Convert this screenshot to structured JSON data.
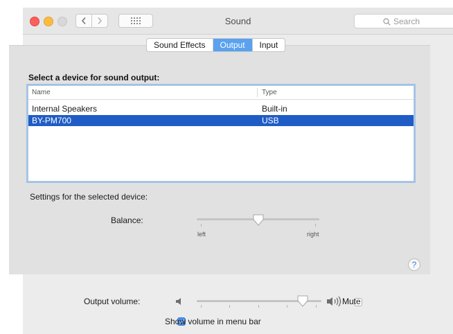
{
  "window": {
    "title": "Sound"
  },
  "search": {
    "placeholder": "Search",
    "icon": "magnifier-icon"
  },
  "tabs": [
    {
      "label": "Sound Effects",
      "active": false
    },
    {
      "label": "Output",
      "active": true
    },
    {
      "label": "Input",
      "active": false
    }
  ],
  "output": {
    "section_title": "Select a device for sound output:",
    "columns": {
      "name": "Name",
      "type": "Type"
    },
    "devices": [
      {
        "name": "Internal Speakers",
        "type": "Built-in",
        "selected": false
      },
      {
        "name": "BY-PM700",
        "type": "USB",
        "selected": true
      }
    ],
    "settings_label": "Settings for the selected device:",
    "balance": {
      "label": "Balance:",
      "left_label": "left",
      "right_label": "right",
      "value": 0.5
    }
  },
  "help": {
    "label": "?"
  },
  "volume": {
    "label": "Output volume:",
    "value": 0.85,
    "mute_label": "Mute",
    "muted": false
  },
  "menu_bar": {
    "label": "Show volume in menu bar",
    "checked": true
  },
  "colors": {
    "accent": "#5aa1ef",
    "selection": "#1f5cc5"
  }
}
